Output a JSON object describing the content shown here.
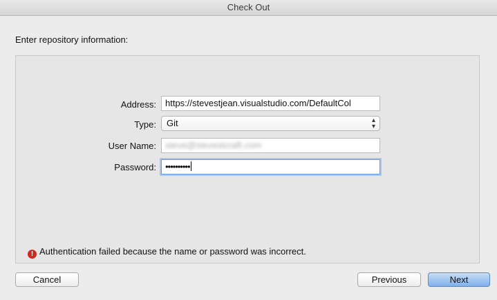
{
  "window": {
    "title": "Check Out"
  },
  "form": {
    "section_label": "Enter repository information:",
    "address_label": "Address:",
    "address_value": "https://stevestjean.visualstudio.com/DefaultCol",
    "type_label": "Type:",
    "type_value": "Git",
    "username_label": "User Name:",
    "username_value": "steve@stevestcraft.com",
    "password_label": "Password:",
    "password_value": "••••••••••"
  },
  "error": {
    "icon": "exclamation-icon",
    "icon_glyph": "!",
    "message": "Authentication failed because the name or password was incorrect."
  },
  "buttons": {
    "cancel": "Cancel",
    "previous": "Previous",
    "next": "Next"
  },
  "colors": {
    "error_icon": "#cc2b22",
    "primary_button": "#7fb0ea",
    "focus_ring": "#a9c7ef"
  }
}
